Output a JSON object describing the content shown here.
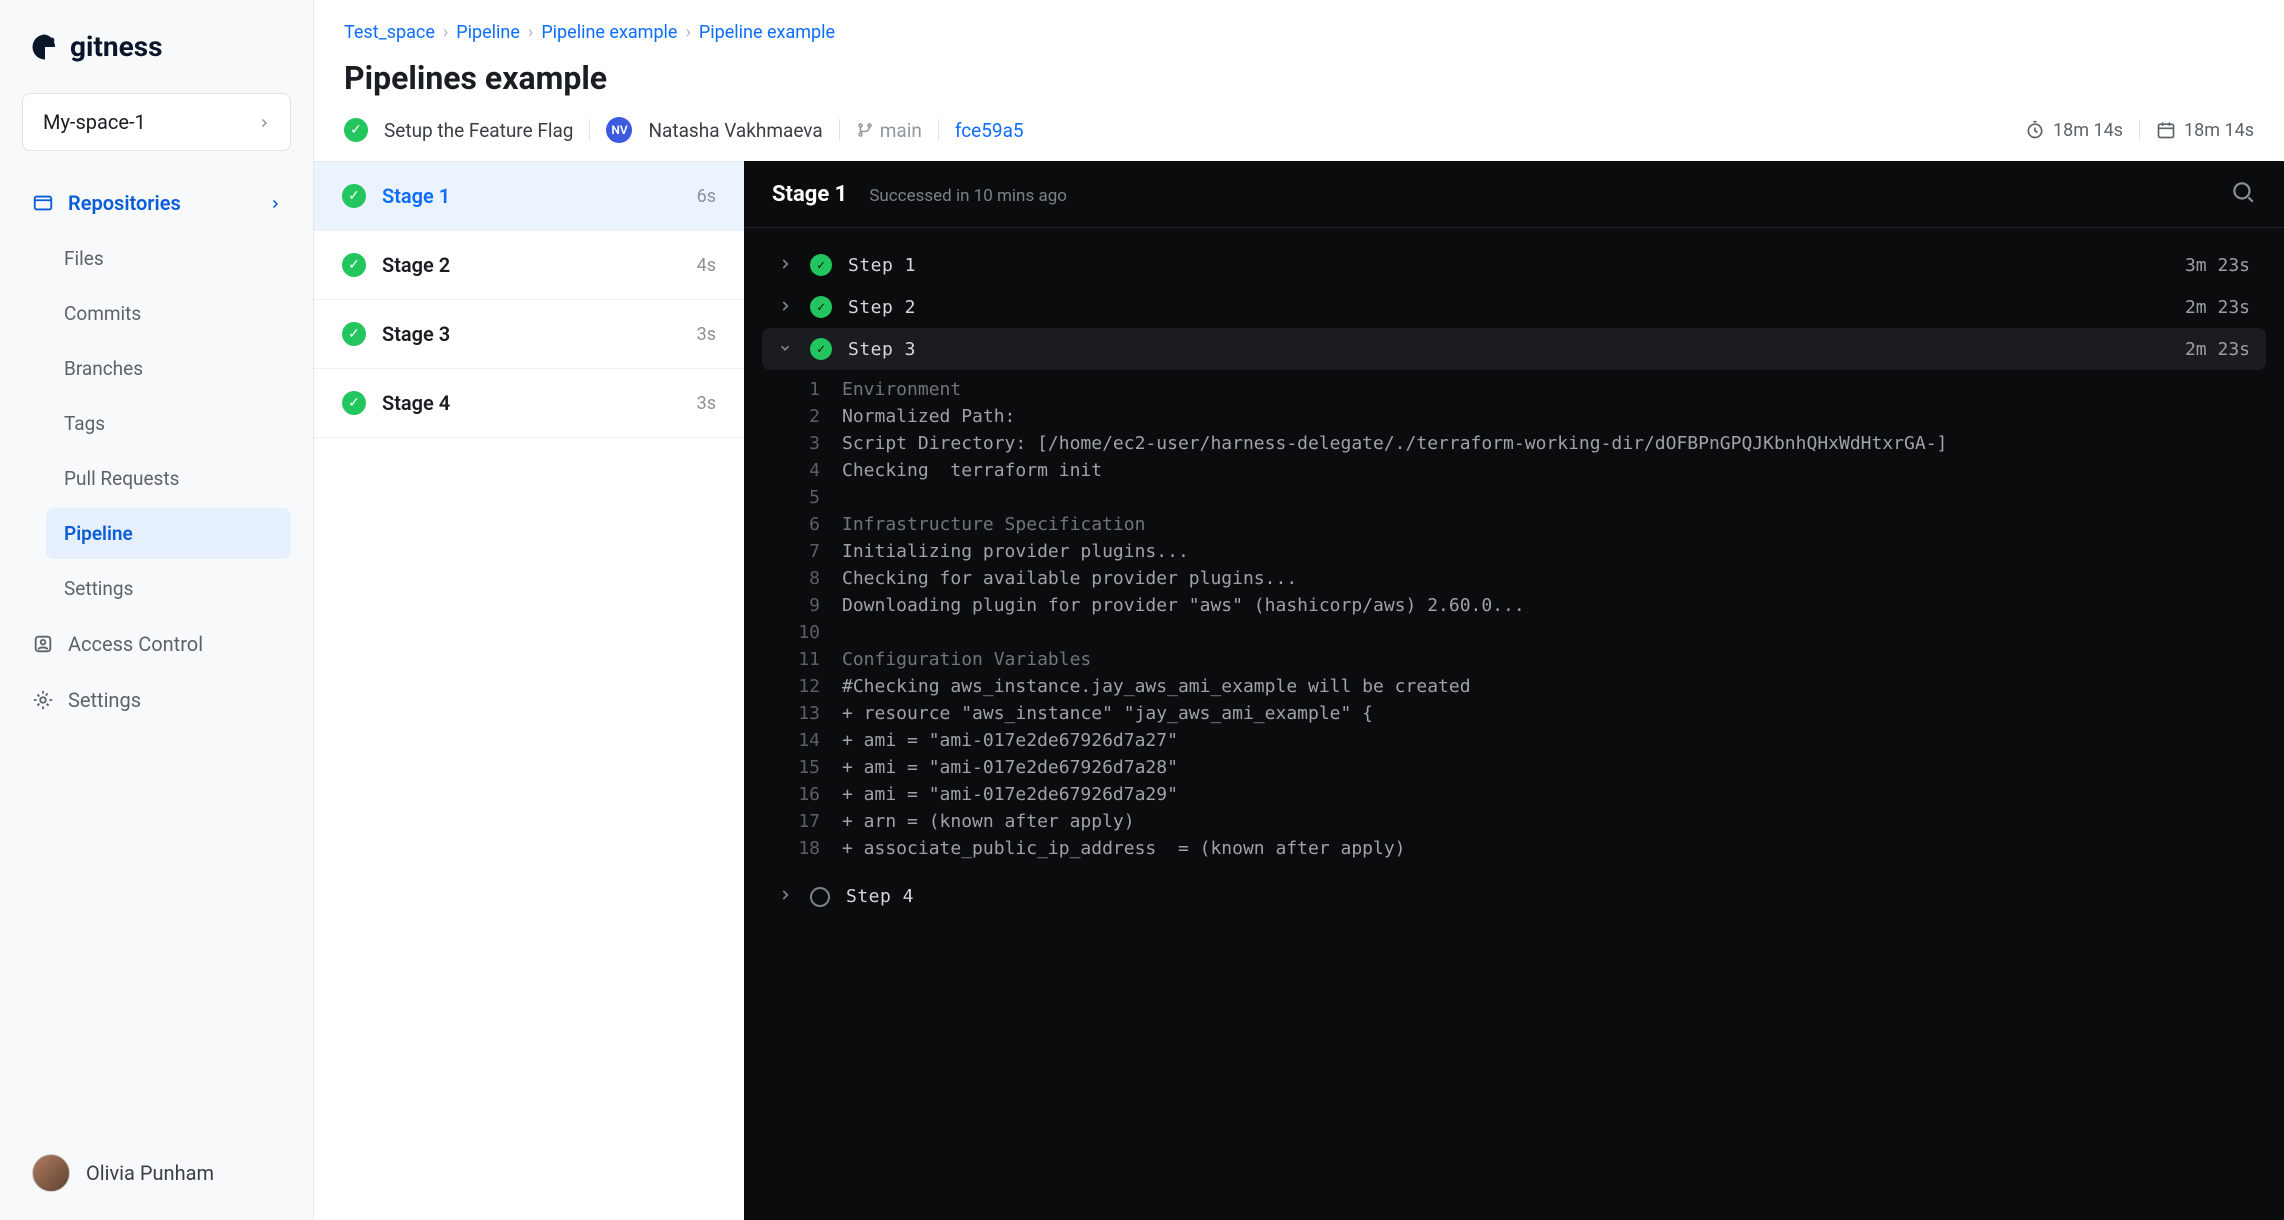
{
  "brand": "gitness",
  "space_selector": "My-space-1",
  "sidebar": {
    "repositories_label": "Repositories",
    "items": [
      "Files",
      "Commits",
      "Branches",
      "Tags",
      "Pull Requests",
      "Pipeline",
      "Settings"
    ],
    "active_index": 5,
    "access_control": "Access Control",
    "settings": "Settings"
  },
  "user": {
    "name": "Olivia Punham"
  },
  "breadcrumb": [
    "Test_space",
    "Pipeline",
    "Pipeline example",
    "Pipeline example"
  ],
  "page_title": "Pipelines example",
  "run_meta": {
    "status_label": "Setup the Feature Flag",
    "author_initials": "NV",
    "author": "Natasha Vakhmaeva",
    "branch": "main",
    "commit": "fce59a5",
    "duration": "18m 14s",
    "timestamp": "18m 14s"
  },
  "stages": [
    {
      "name": "Stage 1",
      "duration": "6s",
      "status": "success",
      "active": true
    },
    {
      "name": "Stage 2",
      "duration": "4s",
      "status": "success",
      "active": false
    },
    {
      "name": "Stage 3",
      "duration": "3s",
      "status": "success",
      "active": false
    },
    {
      "name": "Stage 4",
      "duration": "3s",
      "status": "success",
      "active": false
    }
  ],
  "log": {
    "stage_name": "Stage 1",
    "stage_sub": "Successed in 10 mins ago",
    "steps": [
      {
        "name": "Step 1",
        "duration": "3m 23s",
        "status": "success",
        "expanded": false
      },
      {
        "name": "Step 2",
        "duration": "2m 23s",
        "status": "success",
        "expanded": false
      },
      {
        "name": "Step 3",
        "duration": "2m 23s",
        "status": "success",
        "expanded": true
      },
      {
        "name": "Step 4",
        "duration": "",
        "status": "pending",
        "expanded": false
      }
    ],
    "lines": [
      {
        "n": 1,
        "t": "Environment",
        "dim": true
      },
      {
        "n": 2,
        "t": "Normalized Path:"
      },
      {
        "n": 3,
        "t": "Script Directory: [/home/ec2-user/harness-delegate/./terraform-working-dir/dOFBPnGPQJKbnhQHxWdHtxrGA-]"
      },
      {
        "n": 4,
        "t": "Checking  terraform init"
      },
      {
        "n": 5,
        "t": ""
      },
      {
        "n": 6,
        "t": "Infrastructure Specification",
        "dim": true
      },
      {
        "n": 7,
        "t": "Initializing provider plugins..."
      },
      {
        "n": 8,
        "t": "Checking for available provider plugins..."
      },
      {
        "n": 9,
        "t": "Downloading plugin for provider \"aws\" (hashicorp/aws) 2.60.0..."
      },
      {
        "n": 10,
        "t": ""
      },
      {
        "n": 11,
        "t": "Configuration Variables",
        "dim": true
      },
      {
        "n": 12,
        "t": "#Checking aws_instance.jay_aws_ami_example will be created"
      },
      {
        "n": 13,
        "t": "+ resource \"aws_instance\" \"jay_aws_ami_example\" {"
      },
      {
        "n": 14,
        "t": "+ ami = \"ami-017e2de67926d7a27\""
      },
      {
        "n": 15,
        "t": "+ ami = \"ami-017e2de67926d7a28\""
      },
      {
        "n": 16,
        "t": "+ ami = \"ami-017e2de67926d7a29\""
      },
      {
        "n": 17,
        "t": "+ arn = (known after apply)"
      },
      {
        "n": 18,
        "t": "+ associate_public_ip_address  = (known after apply)"
      }
    ]
  }
}
